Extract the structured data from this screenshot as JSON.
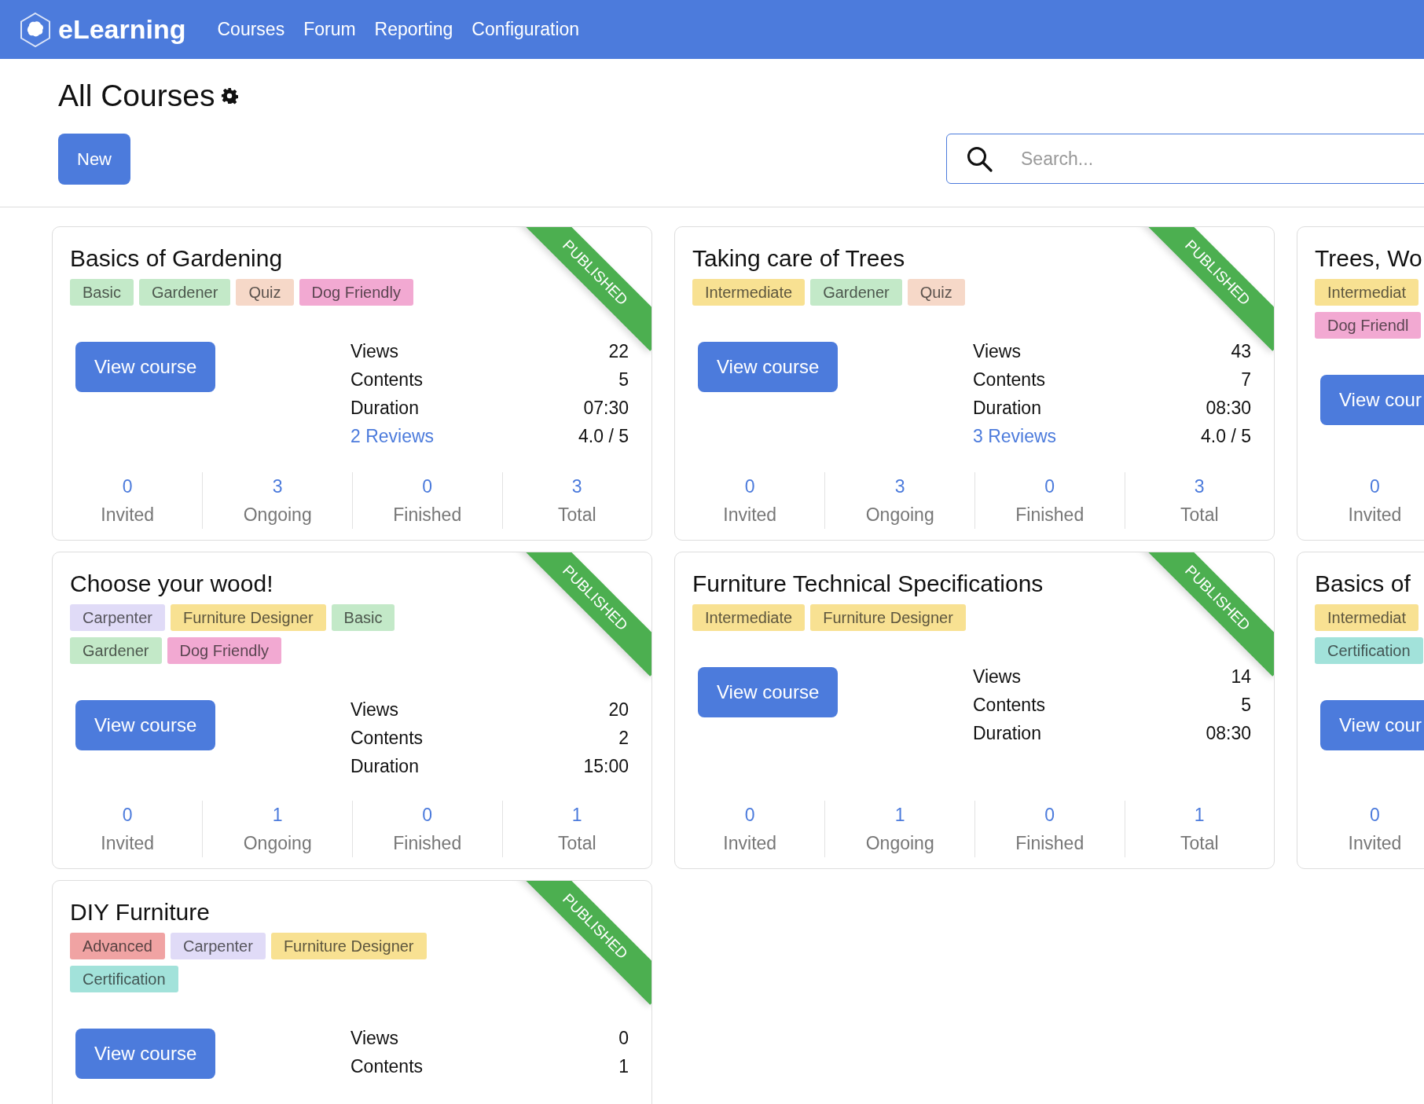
{
  "navbar": {
    "brand": "eLearning",
    "items": [
      {
        "label": "Courses"
      },
      {
        "label": "Forum"
      },
      {
        "label": "Reporting"
      },
      {
        "label": "Configuration"
      }
    ]
  },
  "header": {
    "title": "All Courses",
    "new_button": "New",
    "search": {
      "placeholder": "Search..."
    }
  },
  "courses": [
    {
      "title": "Basics of Gardening",
      "ribbon": "PUBLISHED",
      "tags": [
        {
          "label": "Basic",
          "color": "#c3e9c8"
        },
        {
          "label": "Gardener",
          "color": "#c3e9c8"
        },
        {
          "label": "Quiz",
          "color": "#f6d8c8"
        },
        {
          "label": "Dog Friendly",
          "color": "#f2a9d2"
        }
      ],
      "button": "View course",
      "stats": [
        {
          "label": "Views",
          "value": "22"
        },
        {
          "label": "Contents",
          "value": "5"
        },
        {
          "label": "Duration",
          "value": "07:30"
        }
      ],
      "reviews": {
        "link": "2 Reviews",
        "rating": "4.0 / 5"
      },
      "counts": [
        {
          "value": "0",
          "label": "Invited"
        },
        {
          "value": "3",
          "label": "Ongoing"
        },
        {
          "value": "0",
          "label": "Finished"
        },
        {
          "value": "3",
          "label": "Total"
        }
      ]
    },
    {
      "title": "Taking care of Trees",
      "ribbon": "PUBLISHED",
      "tags": [
        {
          "label": "Intermediate",
          "color": "#f8e192"
        },
        {
          "label": "Gardener",
          "color": "#c3e9c8"
        },
        {
          "label": "Quiz",
          "color": "#f6d8c8"
        }
      ],
      "button": "View course",
      "stats": [
        {
          "label": "Views",
          "value": "43"
        },
        {
          "label": "Contents",
          "value": "7"
        },
        {
          "label": "Duration",
          "value": "08:30"
        }
      ],
      "reviews": {
        "link": "3 Reviews",
        "rating": "4.0 / 5"
      },
      "counts": [
        {
          "value": "0",
          "label": "Invited"
        },
        {
          "value": "3",
          "label": "Ongoing"
        },
        {
          "value": "0",
          "label": "Finished"
        },
        {
          "value": "3",
          "label": "Total"
        }
      ]
    },
    {
      "title": "Trees, Wo",
      "tags": [
        {
          "label": "Intermediat",
          "color": "#f8e192"
        },
        {
          "label": "Dog Friendl",
          "color": "#f2a9d2"
        }
      ],
      "button": "View cour",
      "counts": [
        {
          "value": "0",
          "label": "Invited"
        }
      ]
    },
    {
      "title": "Choose your wood!",
      "ribbon": "PUBLISHED",
      "tags": [
        {
          "label": "Carpenter",
          "color": "#e0dbf7"
        },
        {
          "label": "Furniture Designer",
          "color": "#f8e192"
        },
        {
          "label": "Basic",
          "color": "#c3e9c8"
        },
        {
          "label": "Gardener",
          "color": "#c3e9c8"
        },
        {
          "label": "Dog Friendly",
          "color": "#f2a9d2"
        }
      ],
      "button": "View course",
      "stats": [
        {
          "label": "Views",
          "value": "20"
        },
        {
          "label": "Contents",
          "value": "2"
        },
        {
          "label": "Duration",
          "value": "15:00"
        }
      ],
      "counts": [
        {
          "value": "0",
          "label": "Invited"
        },
        {
          "value": "1",
          "label": "Ongoing"
        },
        {
          "value": "0",
          "label": "Finished"
        },
        {
          "value": "1",
          "label": "Total"
        }
      ]
    },
    {
      "title": "Furniture Technical Specifications",
      "ribbon": "PUBLISHED",
      "tags": [
        {
          "label": "Intermediate",
          "color": "#f8e192"
        },
        {
          "label": "Furniture Designer",
          "color": "#f8e192"
        }
      ],
      "button": "View course",
      "stats": [
        {
          "label": "Views",
          "value": "14"
        },
        {
          "label": "Contents",
          "value": "5"
        },
        {
          "label": "Duration",
          "value": "08:30"
        }
      ],
      "counts": [
        {
          "value": "0",
          "label": "Invited"
        },
        {
          "value": "1",
          "label": "Ongoing"
        },
        {
          "value": "0",
          "label": "Finished"
        },
        {
          "value": "1",
          "label": "Total"
        }
      ]
    },
    {
      "title": "Basics of",
      "tags": [
        {
          "label": "Intermediat",
          "color": "#f8e192"
        },
        {
          "label": "Certification",
          "color": "#a2e2da"
        }
      ],
      "button": "View cour",
      "counts": [
        {
          "value": "0",
          "label": "Invited"
        }
      ]
    },
    {
      "title": "DIY Furniture",
      "ribbon": "PUBLISHED",
      "tags": [
        {
          "label": "Advanced",
          "color": "#f0a3a3"
        },
        {
          "label": "Carpenter",
          "color": "#e0dbf7"
        },
        {
          "label": "Furniture Designer",
          "color": "#f8e192"
        },
        {
          "label": "Certification",
          "color": "#a2e2da"
        }
      ],
      "button": "View course",
      "stats": [
        {
          "label": "Views",
          "value": "0"
        },
        {
          "label": "Contents",
          "value": "1"
        }
      ]
    }
  ]
}
